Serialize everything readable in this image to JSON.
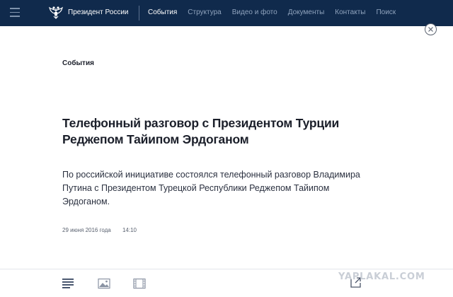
{
  "header": {
    "site_title": "Президент России",
    "nav": [
      {
        "label": "События",
        "active": true
      },
      {
        "label": "Структура",
        "active": false
      },
      {
        "label": "Видео и фото",
        "active": false
      },
      {
        "label": "Документы",
        "active": false
      },
      {
        "label": "Контакты",
        "active": false
      },
      {
        "label": "Поиск",
        "active": false
      }
    ],
    "icons": {
      "menu": "hamburger-icon",
      "emblem": "double-headed-eagle-emblem"
    }
  },
  "article": {
    "section": "События",
    "title": "Телефонный разговор с Президентом Турции Реджепом Тайипом Эрдоганом",
    "lead": "По российской инициативе состоялся телефонный разговор Владимира Путина с Президентом Турецкой Республики Реджепом Тайипом Эрдоганом.",
    "date": "29 июня 2016 года",
    "time": "14:10"
  },
  "toolbar": {
    "icons": [
      "text-view-icon",
      "photo-icon",
      "video-icon",
      "share-icon"
    ]
  },
  "watermark": "YAPLAKAL.COM",
  "colors": {
    "header_bg": "#102a4c",
    "nav_inactive": "#8fa3bd",
    "text": "#1b1f2a"
  }
}
